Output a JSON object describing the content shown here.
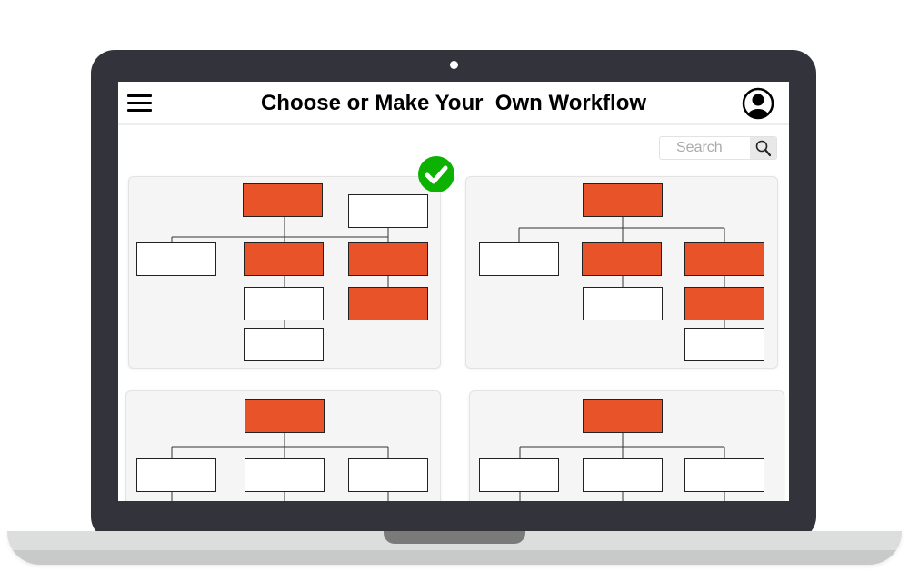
{
  "header": {
    "title": "Choose or Make Your  Own Workflow",
    "menu_icon": "hamburger-menu-icon",
    "profile_icon": "user-profile-icon"
  },
  "search": {
    "placeholder": "Search",
    "icon": "magnifier-icon"
  },
  "selection": {
    "icon": "check-circle-icon",
    "selected_template": 1
  },
  "colors": {
    "accent": "#e8532a",
    "check": "#0db200",
    "bezel": "#32333b",
    "card": "#f5f5f5"
  }
}
